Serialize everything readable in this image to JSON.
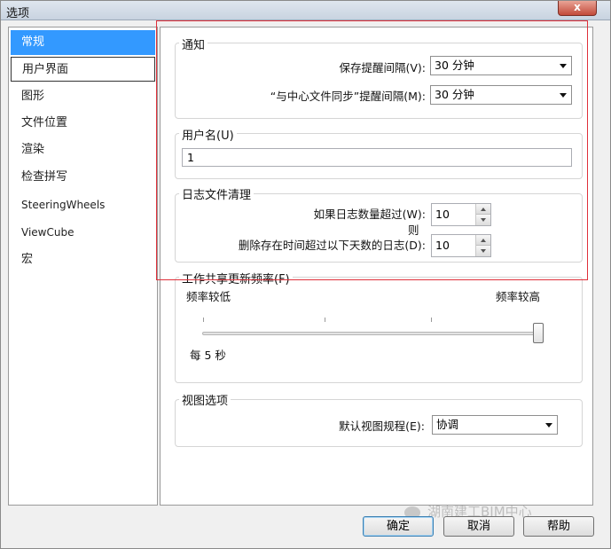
{
  "window": {
    "title": "选项",
    "close_glyph": "x"
  },
  "nav": {
    "items": [
      {
        "label": "常规"
      },
      {
        "label": "用户界面"
      },
      {
        "label": "图形"
      },
      {
        "label": "文件位置"
      },
      {
        "label": "渲染"
      },
      {
        "label": "检查拼写"
      },
      {
        "label": "SteeringWheels"
      },
      {
        "label": "ViewCube"
      },
      {
        "label": "宏"
      }
    ],
    "selected": "常规"
  },
  "notify": {
    "title": "通知",
    "save_reminder_label": "保存提醒间隔(V):",
    "save_reminder_value": "30 分钟",
    "sync_label": "“与中心文件同步”提醒间隔(M):",
    "sync_value": "30 分钟"
  },
  "username": {
    "title": "用户名(U)",
    "value": "1"
  },
  "journal": {
    "title": "日志文件清理",
    "count_label": "如果日志数量超过(W):",
    "count_value": "10",
    "then_label": "则",
    "days_label": "删除存在时间超过以下天数的日志(D):",
    "days_value": "10"
  },
  "worksharing": {
    "title": "工作共享更新频率(F)",
    "low_label": "频率较低",
    "high_label": "频率较高",
    "current_label": "每 5 秒"
  },
  "view_options": {
    "title": "视图选项",
    "discipline_label": "默认视图规程(E):",
    "discipline_value": "协调"
  },
  "buttons": {
    "ok": "确定",
    "cancel": "取消",
    "help": "帮助"
  },
  "watermark": "湖南建工BIM中心",
  "colors": {
    "accent": "#3399ff",
    "highlight_box": "#e0303a"
  }
}
